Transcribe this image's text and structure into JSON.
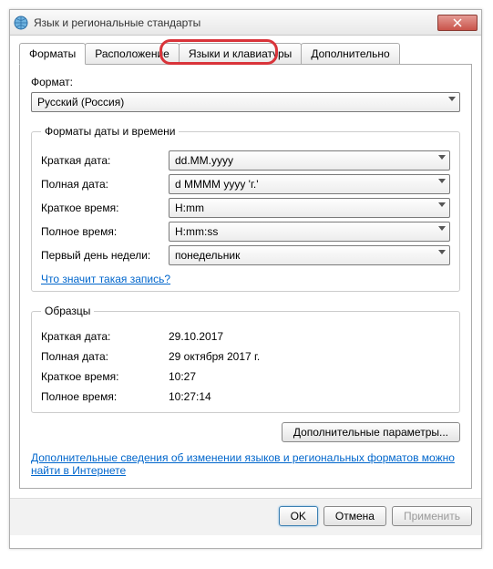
{
  "window": {
    "title": "Язык и региональные стандарты"
  },
  "tabs": {
    "formats": "Форматы",
    "location": "Расположение",
    "keyboards": "Языки и клавиатуры",
    "advanced": "Дополнительно"
  },
  "format": {
    "label": "Формат:",
    "value": "Русский (Россия)"
  },
  "datetime": {
    "legend": "Форматы даты и времени",
    "shortDateLabel": "Краткая дата:",
    "shortDateValue": "dd.MM.yyyy",
    "longDateLabel": "Полная дата:",
    "longDateValue": "d MMMM yyyy 'г.'",
    "shortTimeLabel": "Краткое время:",
    "shortTimeValue": "H:mm",
    "longTimeLabel": "Полное время:",
    "longTimeValue": "H:mm:ss",
    "firstDayLabel": "Первый день недели:",
    "firstDayValue": "понедельник",
    "whatLink": "Что значит такая запись?"
  },
  "samples": {
    "legend": "Образцы",
    "shortDateLabel": "Краткая дата:",
    "shortDateValue": "29.10.2017",
    "longDateLabel": "Полная дата:",
    "longDateValue": "29 октября 2017 г.",
    "shortTimeLabel": "Краткое время:",
    "shortTimeValue": "10:27",
    "longTimeLabel": "Полное время:",
    "longTimeValue": "10:27:14"
  },
  "buttons": {
    "additional": "Дополнительные параметры...",
    "ok": "OK",
    "cancel": "Отмена",
    "apply": "Применить"
  },
  "helpLink": "Дополнительные сведения об изменении языков и региональных форматов можно найти в Интернете"
}
